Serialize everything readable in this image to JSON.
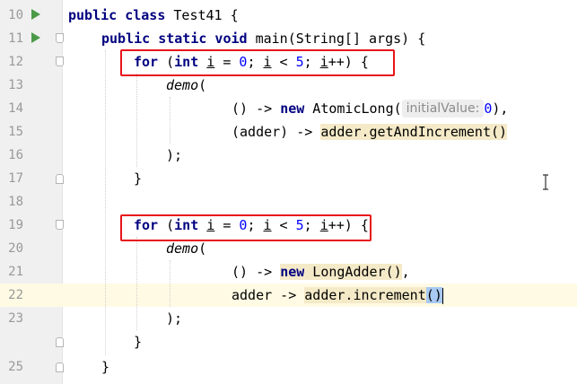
{
  "lines": [
    {
      "num": "10"
    },
    {
      "num": "11"
    },
    {
      "num": "12"
    },
    {
      "num": "13"
    },
    {
      "num": "14"
    },
    {
      "num": "15"
    },
    {
      "num": "16"
    },
    {
      "num": "17"
    },
    {
      "num": "18"
    },
    {
      "num": "19"
    },
    {
      "num": "20"
    },
    {
      "num": "21"
    },
    {
      "num": "22"
    },
    {
      "num": "23"
    },
    {
      "num": "25"
    }
  ],
  "tokens": {
    "l10": {
      "kw1": "public class",
      "rest": " Test41 {"
    },
    "l11": {
      "kw1": "public static void",
      "rest": " main(String[] args) {"
    },
    "l12": {
      "kw_for": "for",
      "p1": " (",
      "kw_int": "int",
      "sp": " ",
      "var_i": "i",
      "eq": " = ",
      "n0": "0",
      "semi": "; ",
      "var_i2": "i",
      "lt": " < ",
      "n5": "5",
      "semi2": "; ",
      "var_i3": "i",
      "inc": "++) {"
    },
    "l13": {
      "call": "demo",
      "open": "("
    },
    "l14": {
      "a": "() -> ",
      "kw_new": "new",
      "b": " AtomicLong(",
      "hint": "initialValue:",
      "n0": "0",
      "c": "),"
    },
    "l15": {
      "a": "(adder) -> ",
      "hl": "adder.getAndIncrement()"
    },
    "l16": {
      "a": ");"
    },
    "l17": {
      "a": "}"
    },
    "l19": {
      "kw_for": "for",
      "p1": " (",
      "kw_int": "int",
      "sp": " ",
      "var_i": "i",
      "eq": " = ",
      "n0": "0",
      "semi": "; ",
      "var_i2": "i",
      "lt": " < ",
      "n5": "5",
      "semi2": "; ",
      "var_i3": "i",
      "inc": "++) {"
    },
    "l20": {
      "call": "demo",
      "open": "("
    },
    "l21": {
      "a": "() -> ",
      "hl_new": "new",
      "hl_b": " LongAdder()",
      "c": ","
    },
    "l22": {
      "a": "adder -> ",
      "hl": "adder.increment",
      "paren": "()"
    },
    "l23": {
      "a": ");"
    },
    "l24": {
      "a": "}"
    },
    "l25": {
      "a": "}"
    }
  },
  "colors": {
    "keyword": "#000080",
    "number": "#0000ff",
    "highlight": "#f5eac8",
    "current_line": "#fffae3",
    "annotation_box": "#e8141a",
    "run_icon": "#4a9a48"
  }
}
